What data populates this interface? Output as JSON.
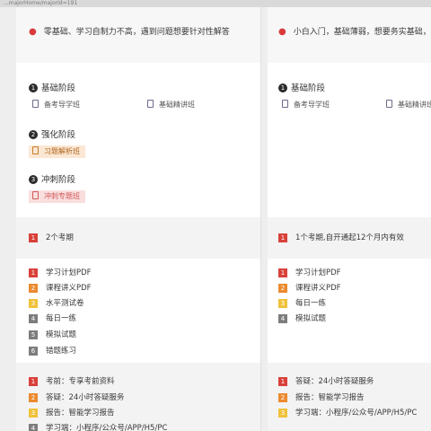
{
  "url_text": "...majorHome/majorId=191",
  "colors": {
    "red": "#d9403a",
    "orange": "#ec8a2f",
    "yellow": "#f0c23b",
    "gray": "#7d7d7d"
  },
  "left": {
    "intro": "零基础、学习自制力不高，遇到问题想要针对性解答",
    "stages": [
      {
        "num": "1",
        "title": "基础阶段",
        "courses": [
          {
            "label": "备考导学班",
            "style": "plain",
            "icon": "book-icon"
          },
          {
            "label": "基础精讲班",
            "style": "plain",
            "icon": "book-icon"
          }
        ]
      },
      {
        "num": "2",
        "title": "强化阶段",
        "courses": [
          {
            "label": "习题解析班",
            "style": "orange",
            "icon": "book-icon"
          }
        ]
      },
      {
        "num": "3",
        "title": "冲刺阶段",
        "courses": [
          {
            "label": "冲刺专题班",
            "style": "pink",
            "icon": "book-icon"
          }
        ]
      }
    ],
    "period": {
      "num": "1",
      "text": "2个考期"
    },
    "materials": [
      {
        "num": "1",
        "text": "学习计划PDF",
        "color": "red"
      },
      {
        "num": "2",
        "text": "课程讲义PDF",
        "color": "orange"
      },
      {
        "num": "3",
        "text": "水平测试卷",
        "color": "yellow"
      },
      {
        "num": "4",
        "text": "每日一练",
        "color": "gray"
      },
      {
        "num": "5",
        "text": "模拟试题",
        "color": "gray"
      },
      {
        "num": "6",
        "text": "错题练习",
        "color": "gray"
      }
    ],
    "services": [
      {
        "num": "1",
        "text": "考前：专享考前资料",
        "color": "red"
      },
      {
        "num": "2",
        "text": "答疑：24小时答疑服务",
        "color": "orange"
      },
      {
        "num": "3",
        "text": "报告：智能学习报告",
        "color": "yellow"
      },
      {
        "num": "4",
        "text": "学习端：小程序/公众号/APP/H5/PC",
        "color": "gray"
      }
    ]
  },
  "right": {
    "intro": "小白入门，基础薄弱，想要务实基础，自学能",
    "stages": [
      {
        "num": "1",
        "title": "基础阶段",
        "courses": [
          {
            "label": "备考导学班",
            "style": "plain",
            "icon": "book-icon"
          },
          {
            "label": "基础精讲班",
            "style": "plain",
            "icon": "book-icon"
          }
        ]
      }
    ],
    "period": {
      "num": "1",
      "text": "1个考期,自开通起12个月内有效"
    },
    "materials": [
      {
        "num": "1",
        "text": "学习计划PDF",
        "color": "red"
      },
      {
        "num": "2",
        "text": "课程讲义PDF",
        "color": "orange"
      },
      {
        "num": "3",
        "text": "每日一练",
        "color": "yellow"
      },
      {
        "num": "4",
        "text": "模拟试题",
        "color": "gray"
      }
    ],
    "services": [
      {
        "num": "1",
        "text": "答疑：24小时答疑服务",
        "color": "red"
      },
      {
        "num": "2",
        "text": "报告：智能学习报告",
        "color": "orange"
      },
      {
        "num": "3",
        "text": "学习端：小程序/公众号/APP/H5/PC",
        "color": "yellow"
      }
    ]
  }
}
